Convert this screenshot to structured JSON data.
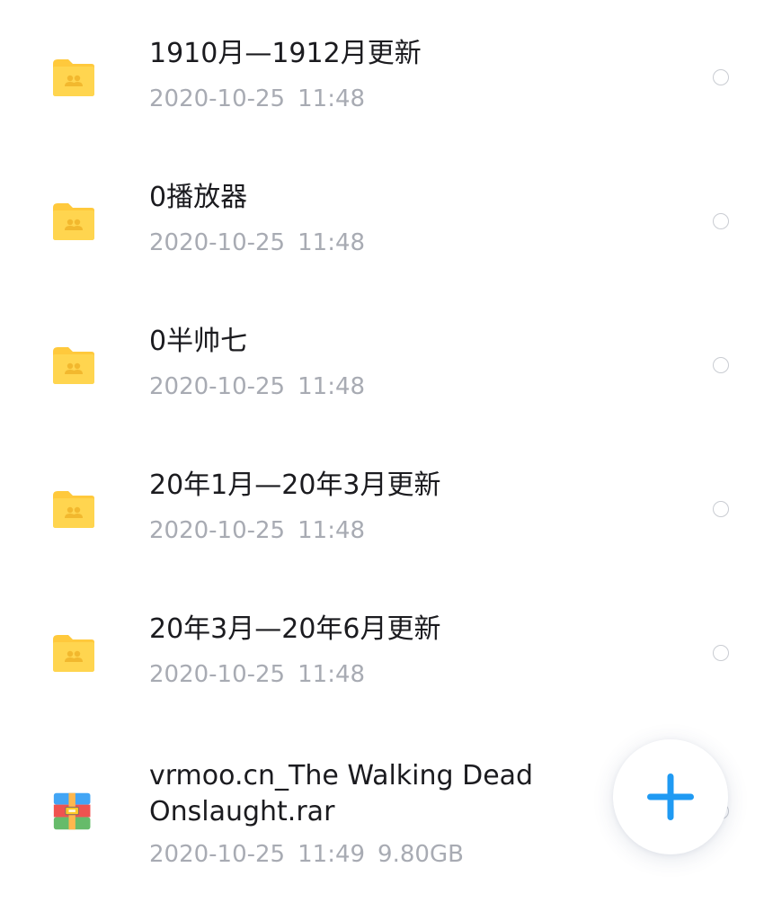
{
  "files": [
    {
      "type": "folder",
      "name": "1910月—1912月更新",
      "date": "2020-10-25",
      "time": "11:48",
      "size": ""
    },
    {
      "type": "folder",
      "name": "0播放器",
      "date": "2020-10-25",
      "time": "11:48",
      "size": ""
    },
    {
      "type": "folder",
      "name": "0半帅七",
      "date": "2020-10-25",
      "time": "11:48",
      "size": ""
    },
    {
      "type": "folder",
      "name": "20年1月—20年3月更新",
      "date": "2020-10-25",
      "time": "11:48",
      "size": ""
    },
    {
      "type": "folder",
      "name": "20年3月—20年6月更新",
      "date": "2020-10-25",
      "time": "11:48",
      "size": ""
    },
    {
      "type": "archive",
      "name_line1": "vrmoo.cn_The Walking Dead",
      "name_line2": "Onslaught.rar",
      "date": "2020-10-25",
      "time": "11:49",
      "size": "9.80GB"
    }
  ],
  "icons": {
    "folder": "shared-folder-icon",
    "archive": "rar-archive-icon",
    "fab": "plus-icon"
  },
  "colors": {
    "folder": "#ffd54f",
    "folder_tab": "#ffc93c",
    "folder_glyph": "#f2b82e",
    "title_text": "#1b1b1f",
    "meta_text": "#a8abb3",
    "accent": "#1f9af3"
  }
}
